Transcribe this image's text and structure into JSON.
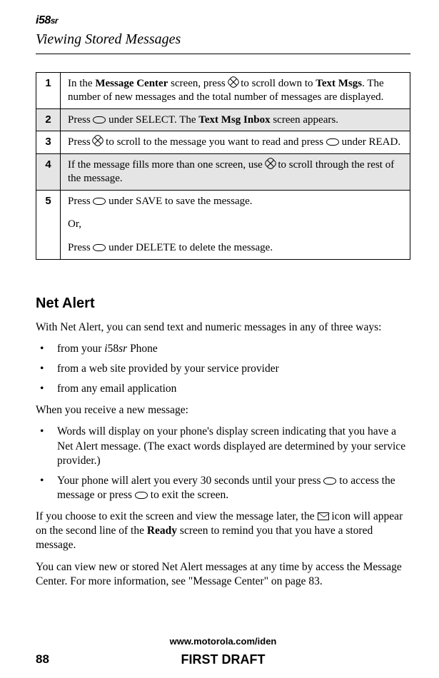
{
  "logo": {
    "prefix": "i",
    "num": "58",
    "suffix": "sr"
  },
  "section_title": "Viewing Stored Messages",
  "steps": [
    {
      "n": "1",
      "text_a": "In the ",
      "bold_a": "Message Center",
      "text_b": " screen, press ",
      "icon": "nav",
      "text_c": " to scroll down to ",
      "bold_b": "Text Msgs",
      "text_d": ". The number of new messages and the total number of messages are displayed."
    },
    {
      "n": "2",
      "text_a": "Press ",
      "icon": "softkey",
      "text_b": " under SELECT. The ",
      "bold_a": "Text Msg Inbox",
      "text_c": " screen appears."
    },
    {
      "n": "3",
      "text_a": "Press ",
      "icon": "nav",
      "text_b": " to scroll to the message you want to read and press ",
      "icon2": "softkey",
      "text_c": " under READ."
    },
    {
      "n": "4",
      "text_a": "If the message fills more than one screen, use ",
      "icon": "nav",
      "text_b": " to scroll through the rest of the message."
    },
    {
      "n": "5",
      "line1_a": "Press ",
      "line1_b": " under SAVE to save the message.",
      "line2": "Or,",
      "line3_a": "Press ",
      "line3_b": " under DELETE to delete the message."
    }
  ],
  "heading2": "Net Alert",
  "intro": "With Net Alert, you can send text and numeric messages in any of three ways:",
  "ways": {
    "a_pre": "from your ",
    "a_model_i": "i",
    "a_model_num": "58",
    "a_model_suf": "sr",
    "a_post": " Phone",
    "b": "from a web site provided by your service provider",
    "c": "from any email application"
  },
  "recv_intro": "When you receive a new message:",
  "recv": {
    "a": "Words will display on your phone's display screen indicating that you have a Net Alert message. (The exact words displayed are determined by your service provider.)",
    "b_pre": "Your phone will alert you every 30 seconds until your press ",
    "b_mid": " to access the message or press ",
    "b_post": " to exit the screen."
  },
  "exit_para": {
    "a": "If you choose to exit the screen and view the message later, the ",
    "b": "  icon will appear on the second line of the ",
    "ready": "Ready",
    "c": " screen to remind you that you have a stored message."
  },
  "view_para": "You can view new or stored Net Alert messages at any time by access the Message Center. For more information, see \"Message Center\" on page 83.",
  "footer": {
    "url": "www.motorola.com/iden",
    "page": "88",
    "draft": "FIRST DRAFT"
  }
}
